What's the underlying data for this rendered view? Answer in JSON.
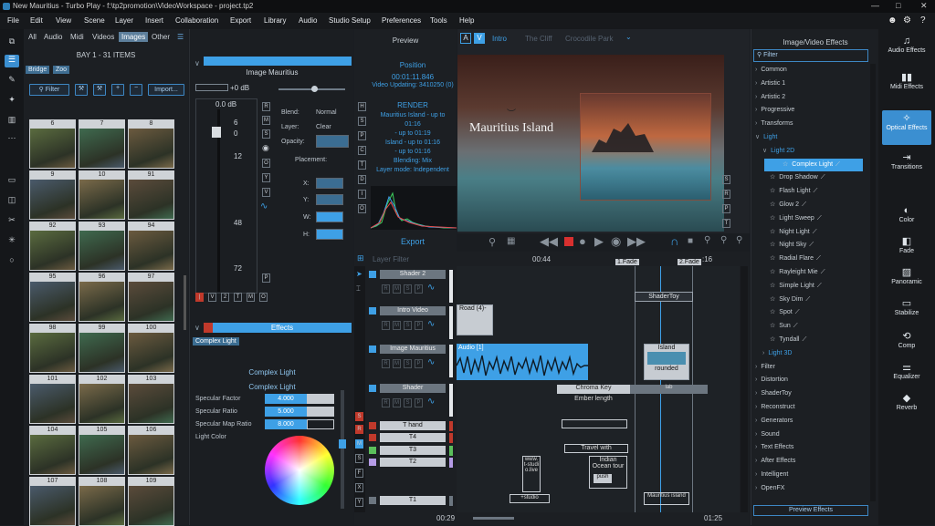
{
  "title_bar": {
    "title": "New Mauritius - Turbo Play - f:\\tp2promotion\\VideoWorkspace - project.tp2",
    "min": "—",
    "max": "□",
    "close": "✕"
  },
  "menu": [
    "File",
    "Edit",
    "View",
    "Scene",
    "Layer",
    "Insert",
    "Collaboration",
    "Export",
    "Library",
    "Audio",
    "Studio Setup",
    "Preferences",
    "Tools",
    "Help"
  ],
  "media": {
    "tabs": [
      "All",
      "Audio",
      "Midi",
      "Videos",
      "Images",
      "Other"
    ],
    "active_tab": "Images",
    "bay_title": "BAY 1 - 31 ITEMS",
    "chips": [
      "Bridge",
      "Zoo"
    ],
    "filter_label": "Filter",
    "import_label": "Import...",
    "thumb_labels": [
      "6",
      "7",
      "8",
      "9",
      "10",
      "91",
      "92",
      "93",
      "94",
      "95",
      "96",
      "97",
      "98",
      "99",
      "100",
      "101",
      "102",
      "103",
      "104",
      "105",
      "106",
      "107",
      "108",
      "109"
    ]
  },
  "props": {
    "clip_name": "Image Mauritius",
    "db_label": "+0 dB",
    "meter_top": "0.0 dB",
    "ticks": [
      "6",
      "0",
      "12",
      "48",
      "72"
    ],
    "blend_label": "Blend:",
    "blend_value": "Normal",
    "layer_label": "Layer:",
    "layer_value": "Clear",
    "opacity_label": "Opacity:",
    "placement_label": "Placement:",
    "x": "X:",
    "y": "Y:",
    "w": "W:",
    "h": "H:",
    "side_btns": [
      "R",
      "M",
      "S",
      "O",
      "Y",
      "V",
      "P"
    ],
    "bottom_btns": [
      "V",
      "2",
      "T",
      "M",
      "O"
    ],
    "effects_header": "Effects",
    "effect_chip": "Complex Light",
    "complex_title": "Complex Light",
    "complex_sub": "Complex Light",
    "params": [
      {
        "label": "Specular Factor",
        "value": "4.000"
      },
      {
        "label": "Specular Ratio",
        "value": "5.000"
      },
      {
        "label": "Specular Map Ratio",
        "value": "8.000"
      }
    ],
    "light_color": "Light Color"
  },
  "preview": {
    "header": "Preview",
    "position_label": "Position",
    "time": "00:01:11.846",
    "updating": "Video Updating: 3410250 (0)",
    "render": "RENDER",
    "lines": [
      "Mauritius Island - up to",
      "01:16",
      "- up to 01:19",
      "Island - up to 01:16",
      "- up to 01:16",
      "Blending: Mix",
      "Layer mode: Independent"
    ],
    "export_label": "Export",
    "side_btns": [
      "H",
      "S",
      "P",
      "C",
      "T",
      "D",
      "I",
      "O"
    ]
  },
  "viewer": {
    "tab_a": "A",
    "tab_v": "V",
    "tabs": [
      "Intro",
      "The Cliff",
      "Crocodile Park"
    ],
    "overlay_text": "Mauritius Island",
    "side_btns": [
      "S",
      "R",
      "P",
      "T"
    ]
  },
  "timeline": {
    "layer_filter": "Layer Filter",
    "time_start": "00:44",
    "fade1": "1.Fade",
    "fade2": "2.Fade",
    "time_end": ":16",
    "tracks": [
      {
        "name": "Shader 2"
      },
      {
        "name": "Intro Video"
      },
      {
        "name": "Image Mauritius"
      },
      {
        "name": "Shader"
      },
      {
        "name": "T hand"
      },
      {
        "name": "T4"
      },
      {
        "name": "T3"
      },
      {
        "name": "T2"
      },
      {
        "name": "T1"
      }
    ],
    "clips": {
      "shadertoy": "ShaderToy",
      "road": "Road (4)-",
      "audio": "Audio [1]",
      "island": "Island",
      "rounded": "rounded",
      "chroma": "Chroma Key",
      "ember": "Ember length",
      "travel": "Travel with",
      "indian": "Indian Ocean tour",
      "www": "www. t-studi o.live",
      "studio": "+studio",
      "mauritius_island": "Mauritius island",
      "push": "push",
      "lab": "lab"
    },
    "foot_left": "00:29",
    "foot_right": "01:25",
    "left_btns": [
      "S",
      "R",
      "M",
      "S",
      "F",
      "X",
      "Y"
    ]
  },
  "effects": {
    "header": "Image/Video Effects",
    "filter": "Filter",
    "items": [
      {
        "label": "Common",
        "lvl": 0
      },
      {
        "label": "Artistic 1",
        "lvl": 0
      },
      {
        "label": "Artistic 2",
        "lvl": 0
      },
      {
        "label": "Progressive",
        "lvl": 0
      },
      {
        "label": "Transforms",
        "lvl": 0
      },
      {
        "label": "Light",
        "lvl": 0,
        "open": true
      },
      {
        "label": "Light 2D",
        "lvl": 1,
        "open": true
      },
      {
        "label": "Complex Light",
        "lvl": 2,
        "sel": true
      },
      {
        "label": "Drop Shadow",
        "lvl": 2
      },
      {
        "label": "Flash Light",
        "lvl": 2
      },
      {
        "label": "Glow 2",
        "lvl": 2
      },
      {
        "label": "Light Sweep",
        "lvl": 2
      },
      {
        "label": "Night Light",
        "lvl": 2
      },
      {
        "label": "Night Sky",
        "lvl": 2
      },
      {
        "label": "Radial Flare",
        "lvl": 2
      },
      {
        "label": "Rayleight Mie",
        "lvl": 2
      },
      {
        "label": "Simple Light",
        "lvl": 2
      },
      {
        "label": "Sky Dim",
        "lvl": 2
      },
      {
        "label": "Spot",
        "lvl": 2
      },
      {
        "label": "Sun",
        "lvl": 2
      },
      {
        "label": "Tyndall",
        "lvl": 2
      },
      {
        "label": "Light 3D",
        "lvl": 1
      },
      {
        "label": "Filter",
        "lvl": 0
      },
      {
        "label": "Distortion",
        "lvl": 0
      },
      {
        "label": "ShaderToy",
        "lvl": 0
      },
      {
        "label": "Reconstruct",
        "lvl": 0
      },
      {
        "label": "Generators",
        "lvl": 0
      },
      {
        "label": "Sound",
        "lvl": 0
      },
      {
        "label": "Text Effects",
        "lvl": 0
      },
      {
        "label": "After Effects",
        "lvl": 0
      },
      {
        "label": "Intelligent",
        "lvl": 0
      },
      {
        "label": "OpenFX",
        "lvl": 0
      }
    ],
    "preview_btn": "Preview Effects"
  },
  "rightbar": [
    {
      "label": "Audio Effects",
      "icon": "music-icon"
    },
    {
      "label": "Midi Effects",
      "icon": "midi-icon"
    },
    {
      "label": "Optical Effects",
      "icon": "sparkle-icon",
      "active": true
    },
    {
      "label": "Transitions",
      "icon": "transition-icon"
    },
    {
      "label": "Color",
      "icon": "color-icon"
    },
    {
      "label": "Fade",
      "icon": "fade-icon"
    },
    {
      "label": "Panoramic",
      "icon": "panoramic-icon"
    },
    {
      "label": "Stabilize",
      "icon": "stabilize-icon"
    },
    {
      "label": "Comp",
      "icon": "comp-icon"
    },
    {
      "label": "Equalizer",
      "icon": "equalizer-icon"
    },
    {
      "label": "Reverb",
      "icon": "reverb-icon"
    }
  ]
}
